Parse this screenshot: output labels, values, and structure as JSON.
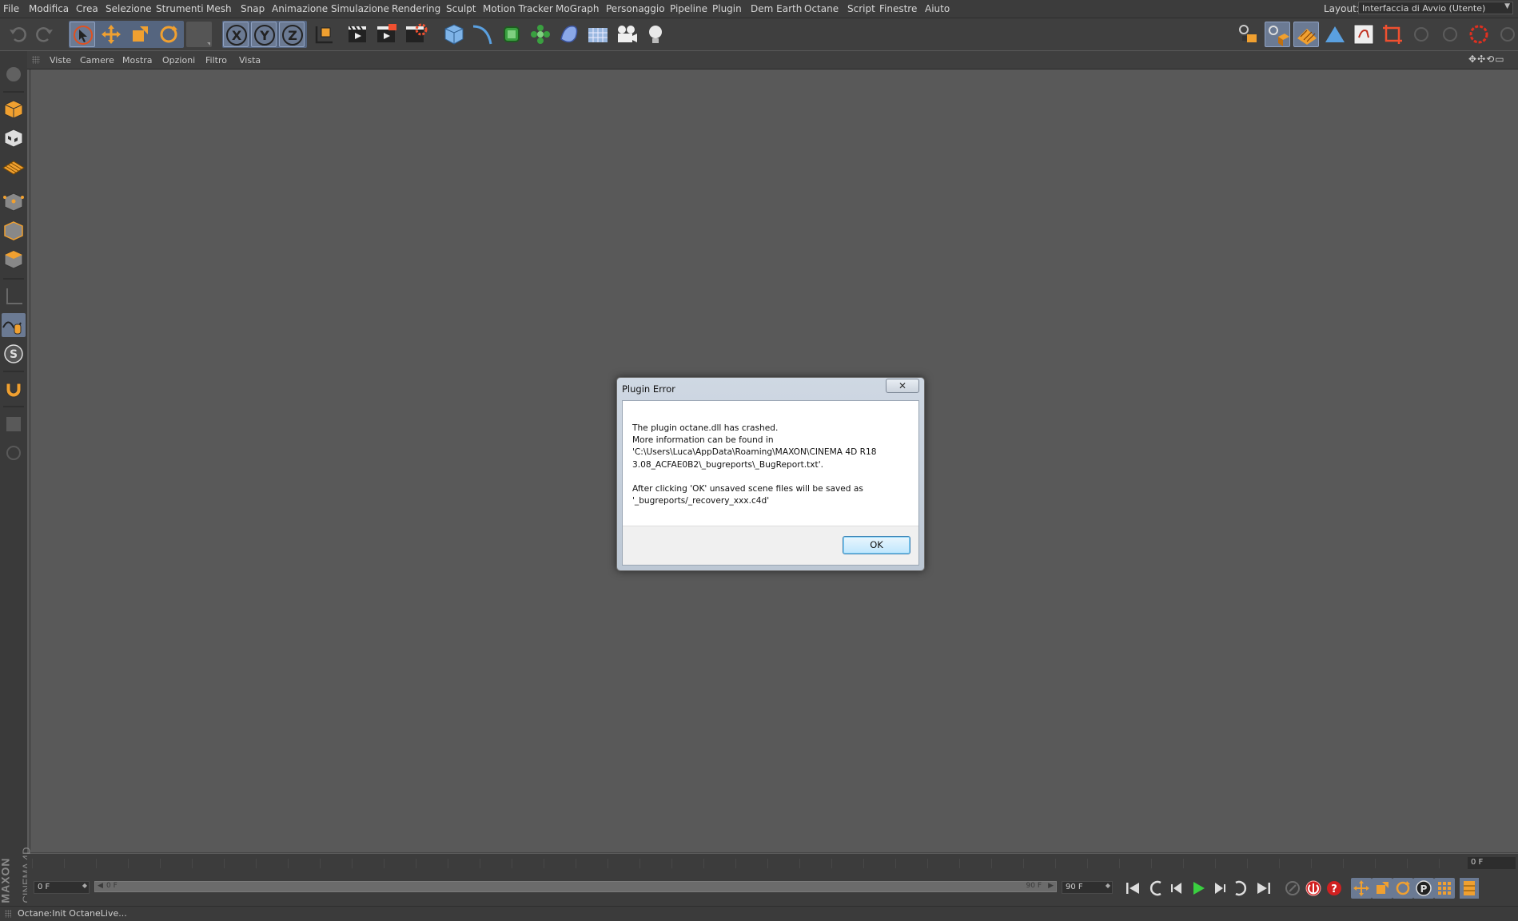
{
  "menubar": {
    "items": [
      "File",
      "Modifica",
      "Crea",
      "Selezione",
      "Strumenti",
      "Mesh",
      "Snap",
      "Animazione",
      "Simulazione",
      "Rendering",
      "Sculpt",
      "Motion Tracker",
      "MoGraph",
      "Personaggio",
      "Pipeline",
      "Plugin",
      "Dem Earth",
      "Octane",
      "Script",
      "Finestre",
      "Aiuto"
    ],
    "layout_label": "Layout:",
    "layout_value": "Interfaccia di Avvio (Utente)"
  },
  "toolbar": {
    "icons": [
      "undo-icon",
      "redo-icon",
      "live-selection-icon",
      "move-icon",
      "scale-icon",
      "rotate-icon",
      "recent-tools-icon",
      "x-axis-icon",
      "y-axis-icon",
      "z-axis-icon",
      "coordinate-system-icon",
      "render-view-icon",
      "render-to-picture-viewer-icon",
      "render-settings-icon",
      "cube-icon",
      "spline-pen-icon",
      "subdivision-surface-icon",
      "cloner-icon",
      "deformer-icon",
      "floor-icon",
      "camera-icon",
      "light-icon"
    ],
    "axis_labels": [
      "X",
      "Y",
      "Z"
    ]
  },
  "viewport": {
    "menu": [
      "Viste",
      "Camere",
      "Mostra",
      "Opzioni",
      "Filtro",
      "Vista"
    ]
  },
  "timeline": {
    "current_frame_display": "0 F",
    "start_field": "0 F",
    "slider_start": "0 F",
    "slider_end": "90 F",
    "end_field": "90 F"
  },
  "status": {
    "text": "Octane:Init OctaneLive..."
  },
  "logo": {
    "brand": "MAXON",
    "product": "CINEMA 4D"
  },
  "dialog": {
    "title": "Plugin Error",
    "close_label": "✕",
    "lines": [
      "The plugin octane.dll has crashed.",
      "More information can be found in",
      "'C:\\Users\\Luca\\AppData\\Roaming\\MAXON\\CINEMA 4D R18",
      "3.08_ACFAE0B2\\_bugreports\\_BugReport.txt'.",
      "",
      "After clicking 'OK' unsaved scene files will be saved as",
      "'_bugreports/_recovery_xxx.c4d'"
    ],
    "ok_label": "OK"
  },
  "colors": {
    "ui_background": "#3c3c3c",
    "viewport": "#595959",
    "selection": "#6b7a93",
    "accent_orange": "#f0a030"
  }
}
